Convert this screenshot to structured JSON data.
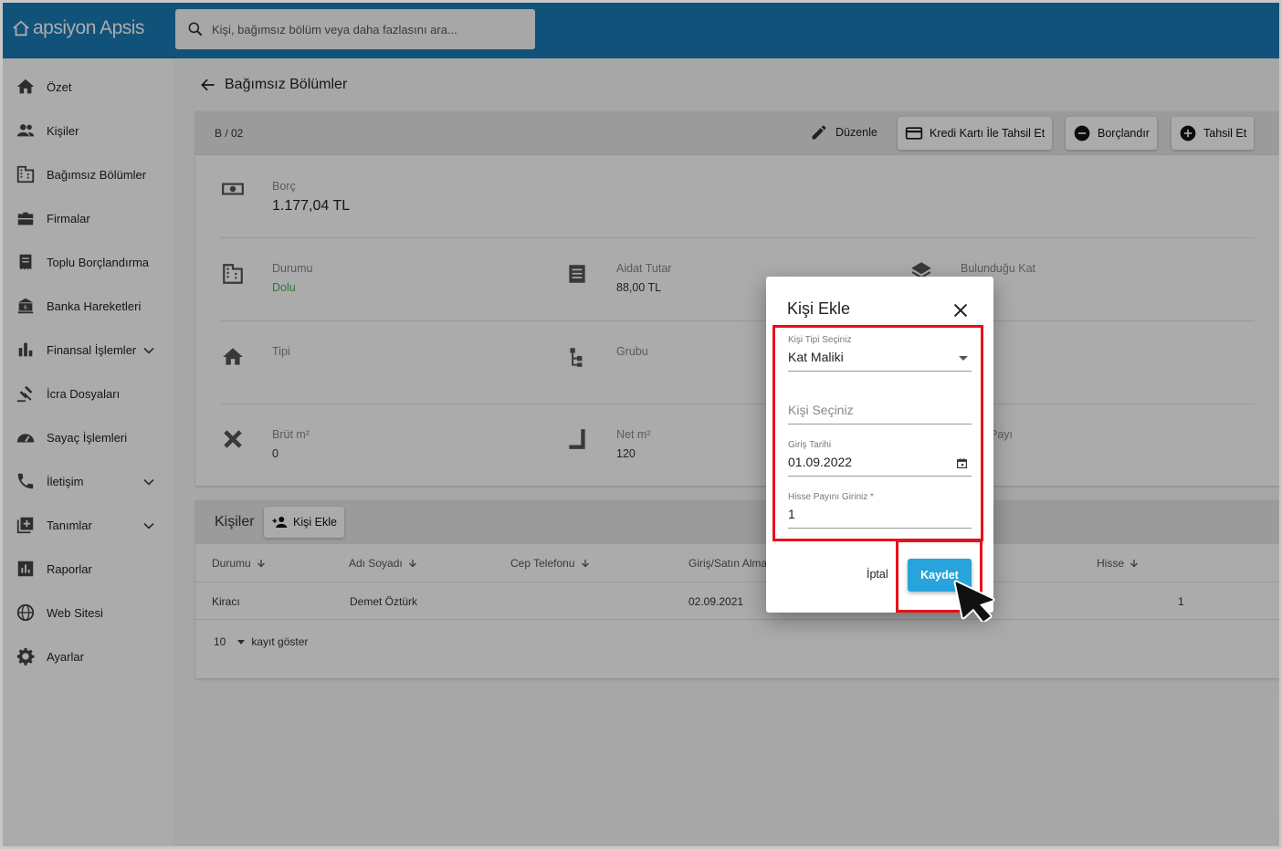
{
  "app": {
    "logo_text": "apsiyon Apsis"
  },
  "search": {
    "placeholder": "Kişi, bağımsız bölüm veya daha fazlasını ara..."
  },
  "sidebar": {
    "items": [
      {
        "label": "Özet",
        "icon": "home-icon"
      },
      {
        "label": "Kişiler",
        "icon": "people-icon"
      },
      {
        "label": "Bağımsız Bölümler",
        "icon": "building-icon"
      },
      {
        "label": "Firmalar",
        "icon": "briefcase-icon"
      },
      {
        "label": "Toplu Borçlandırma",
        "icon": "receipt-icon"
      },
      {
        "label": "Banka Hareketleri",
        "icon": "bank-icon"
      },
      {
        "label": "Finansal İşlemler",
        "icon": "bar-chart-icon"
      },
      {
        "label": "İcra Dosyaları",
        "icon": "gavel-icon"
      },
      {
        "label": "Sayaç İşlemleri",
        "icon": "meter-icon"
      },
      {
        "label": "İletişim",
        "icon": "phone-icon"
      },
      {
        "label": "Tanımlar",
        "icon": "add-box-icon"
      },
      {
        "label": "Raporlar",
        "icon": "report-icon"
      },
      {
        "label": "Web Sitesi",
        "icon": "globe-icon"
      },
      {
        "label": "Ayarlar",
        "icon": "gear-icon"
      }
    ]
  },
  "page": {
    "title": "Bağımsız Bölümler"
  },
  "unit": {
    "code": "B / 02",
    "edit_label": "Düzenle",
    "card_payment_label": "Kredi Kartı İle Tahsil Et",
    "debit_label": "Borçlandır",
    "collect_label": "Tahsil Et",
    "debt_label": "Borç",
    "debt_value": "1.177,04 TL",
    "status_label": "Durumu",
    "status_value": "Dolu",
    "dues_label": "Aidat Tutar",
    "dues_value": "88,00 TL",
    "floor_label": "Bulunduğu Kat",
    "type_label": "Tipi",
    "group_label": "Grubu",
    "gross_label": "Brüt m²",
    "gross_value": "0",
    "net_label": "Net m²",
    "net_value": "120",
    "share_label_partial": "Payı"
  },
  "people": {
    "title": "Kişiler",
    "add_label": "Kişi Ekle",
    "columns": [
      "Durumu",
      "Adı Soyadı",
      "Cep Telefonu",
      "Giriş/Satın Alma",
      "Hisse"
    ],
    "rows": [
      {
        "status": "Kiracı",
        "name": "Demet Öztürk",
        "phone": "",
        "date": "02.09.2021",
        "share": "1"
      }
    ],
    "page_size": "10",
    "page_size_suffix": "kayıt göster"
  },
  "dialog": {
    "title": "Kişi Ekle",
    "person_type_label": "Kişi Tipi Seçiniz",
    "person_type_value": "Kat Maliki",
    "person_placeholder": "Kişi Seçiniz",
    "entry_date_label": "Giriş Tarihi",
    "entry_date_value": "01.09.2022",
    "share_label": "Hisse Payını Giriniz *",
    "share_value": "1",
    "cancel_label": "İptal",
    "save_label": "Kaydet"
  },
  "colors": {
    "topbar": "#1a7bb6",
    "save": "#29a3dc",
    "highlight": "#e8101a",
    "status_green": "#4caf50"
  }
}
